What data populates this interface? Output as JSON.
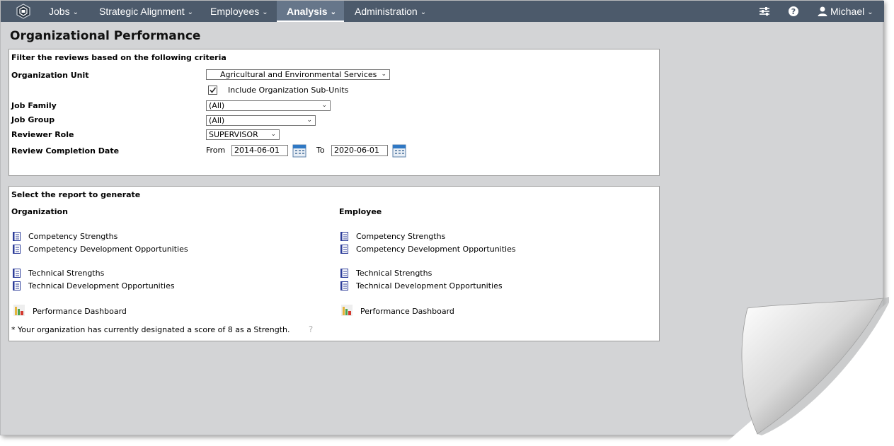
{
  "nav": {
    "items": [
      {
        "label": "Jobs"
      },
      {
        "label": "Strategic Alignment"
      },
      {
        "label": "Employees"
      },
      {
        "label": "Analysis"
      },
      {
        "label": "Administration"
      }
    ],
    "user": "Michael",
    "active_color": "#66768a",
    "bar_color": "#4c5a6b"
  },
  "page": {
    "title": "Organizational Performance"
  },
  "filter": {
    "heading": "Filter the reviews based on the following criteria",
    "org_unit_label": "Organization Unit",
    "org_unit_value": "Agricultural and Environmental Services",
    "include_subunits_label": "Include Organization Sub-Units",
    "include_subunits_checked": true,
    "job_family_label": "Job Family",
    "job_family_value": "(All)",
    "job_group_label": "Job Group",
    "job_group_value": "(All)",
    "reviewer_role_label": "Reviewer Role",
    "reviewer_role_value": "SUPERVISOR",
    "completion_label": "Review Completion Date",
    "from_label": "From",
    "from_value": "2014-06-01",
    "to_label": "To",
    "to_value": "2020-06-01"
  },
  "reports": {
    "heading": "Select the report to generate",
    "org_heading": "Organization",
    "emp_heading": "Employee",
    "org": {
      "competency_strengths": "Competency Strengths",
      "competency_dev": "Competency Development Opportunities",
      "technical_strengths": "Technical Strengths",
      "technical_dev": "Technical Development Opportunities",
      "dashboard": "Performance Dashboard"
    },
    "emp": {
      "competency_strengths": "Competency Strengths",
      "competency_dev": "Competency Development Opportunities",
      "technical_strengths": "Technical Strengths",
      "technical_dev": "Technical Development Opportunities",
      "dashboard": "Performance Dashboard"
    },
    "footnote": "* Your organization has currently designated a score of 8 as a Strength."
  }
}
